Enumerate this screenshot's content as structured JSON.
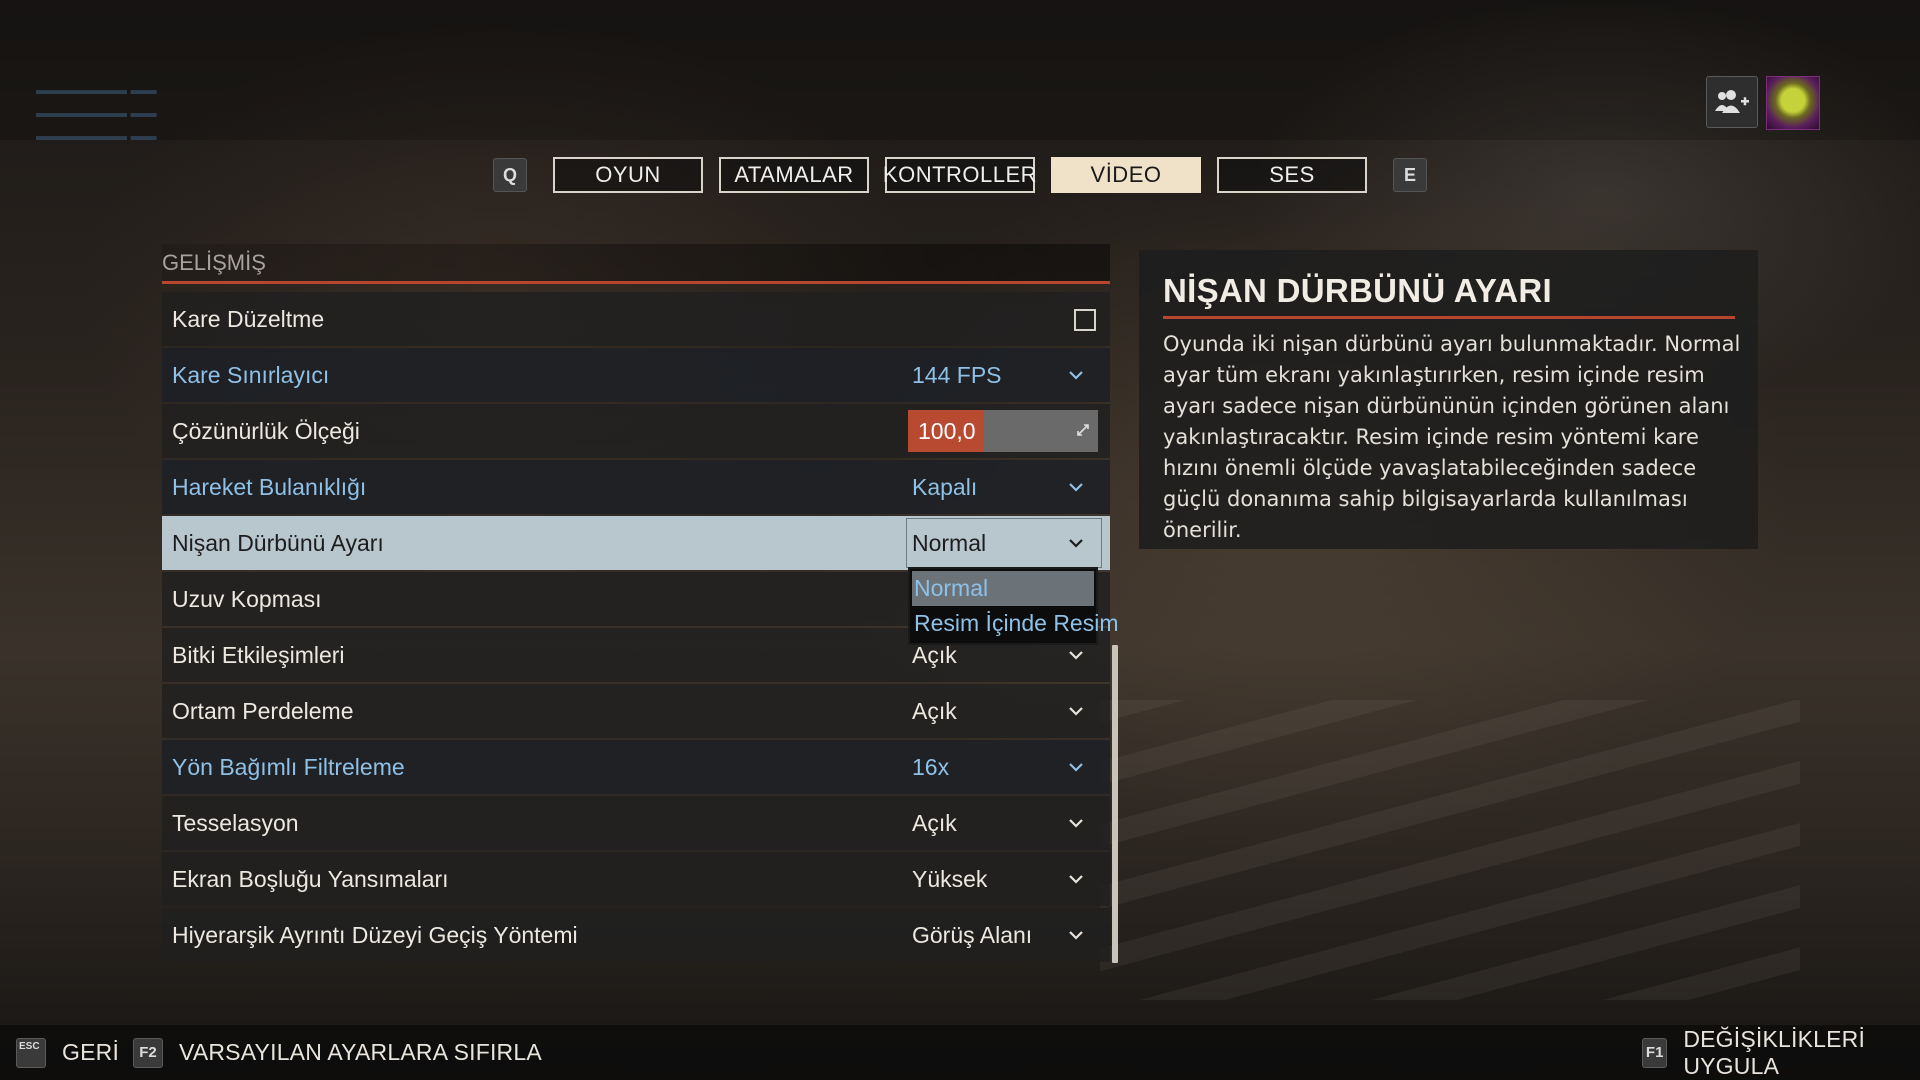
{
  "tabs": {
    "prev_key": "Q",
    "next_key": "E",
    "items": [
      {
        "label": "OYUN"
      },
      {
        "label": "ATAMALAR"
      },
      {
        "label": "KONTROLLER"
      },
      {
        "label": "VİDEO"
      },
      {
        "label": "SES"
      }
    ],
    "active": "VİDEO"
  },
  "section": {
    "title": "GELİŞMİŞ"
  },
  "settings": [
    {
      "label": "Kare Düzeltme",
      "control": "checkbox",
      "checked": false
    },
    {
      "label": "Kare Sınırlayıcı",
      "value": "144 FPS",
      "control": "dropdown"
    },
    {
      "label": "Çözünürlük Ölçeği",
      "value": "100,0",
      "control": "slider",
      "fill_fraction": 0.4
    },
    {
      "label": "Hareket Bulanıklığı",
      "value": "Kapalı",
      "control": "dropdown"
    },
    {
      "label": "Nişan Dürbünü Ayarı",
      "value": "Normal",
      "control": "dropdown",
      "selected": true
    },
    {
      "label": "Uzuv Kopması",
      "value": "",
      "control": "dropdown"
    },
    {
      "label": "Bitki Etkileşimleri",
      "value": "Açık",
      "control": "dropdown"
    },
    {
      "label": "Ortam Perdeleme",
      "value": "Açık",
      "control": "dropdown"
    },
    {
      "label": "Yön Bağımlı Filtreleme",
      "value": "16x",
      "control": "dropdown"
    },
    {
      "label": "Tesselasyon",
      "value": "Açık",
      "control": "dropdown"
    },
    {
      "label": "Ekran Boşluğu Yansımaları",
      "value": "Yüksek",
      "control": "dropdown"
    },
    {
      "label": "Hiyerarşik Ayrıntı Düzeyi Geçiş Yöntemi",
      "value": "Görüş Alanı",
      "control": "dropdown"
    }
  ],
  "dropdown_popup": {
    "options": [
      "Normal",
      "Resim İçinde Resim"
    ],
    "highlighted": "Normal"
  },
  "info": {
    "title": "NİŞAN DÜRBÜNÜ AYARI",
    "body": "Oyunda iki nişan dürbünü ayarı bulunmaktadır. Normal ayar tüm ekranı yakınlaştırırken, resim içinde resim ayarı sadece nişan dürbününün içinden görünen alanı yakınlaştıracaktır. Resim içinde resim yöntemi kare hızını önemli ölçüde yavaşlatabileceğinden sadece güçlü donanıma sahip bilgisayarlarda kullanılması önerilir."
  },
  "bottom_bar": {
    "back_key": "ESC",
    "back_label": "GERİ",
    "reset_key": "F2",
    "reset_label": "VARSAYILAN AYARLARA SIFIRLA",
    "apply_key": "F1",
    "apply_label": "DEĞİŞİKLİKLERİ UYGULA"
  },
  "colors": {
    "accent_red": "#b8452d",
    "active_tab": "#f0e2c9",
    "blue_text": "#8fc0e6",
    "selected_row": "#b8c7cd"
  },
  "icons": {
    "party": "add-party-member-icon",
    "avatar": "player-avatar",
    "chevron": "chevron-down-icon"
  }
}
